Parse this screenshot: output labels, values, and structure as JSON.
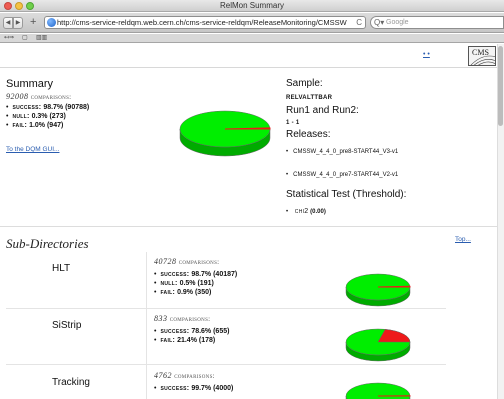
{
  "window": {
    "title": "RelMon Summary"
  },
  "toolbar": {
    "url": "http://cms-service-reldqm.web.cern.ch/cms-service-reldqm/ReleaseMonitoring/CMSSW",
    "search_placeholder": "Google",
    "back_icon": "◀",
    "forward_icon": "▶",
    "add_label": "+",
    "reload_label": "C",
    "search_glyph": "Q▾"
  },
  "bookmarks": {
    "items": [
      "↤⇒",
      "▢",
      "▥▥"
    ]
  },
  "header": {
    "dots_link": "• •",
    "logo_text": "CMS"
  },
  "summary": {
    "title": "Summary",
    "count": "92008",
    "count_suffix": "comparisons:",
    "items": [
      {
        "label": "success:",
        "value": "98.7% (90788)"
      },
      {
        "label": "null:",
        "value": "0.3% (273)"
      },
      {
        "label": "fail:",
        "value": "1.0% (947)"
      }
    ],
    "dqm_link": "To the DQM GUI..."
  },
  "sample": {
    "sample_heading": "Sample:",
    "sample_value": "RELVALTTBAR",
    "run_heading": "Run1 and Run2:",
    "run_value": "1 - 1",
    "releases_heading": "Releases:",
    "releases": [
      "CMSSW_4_4_0_pre8-START44_V3-v1",
      "CMSSW_4_4_0_pre7-START44_V2-v1"
    ],
    "stat_heading": "Statistical Test (Threshold):",
    "stat_label": "chi2",
    "stat_value": "(0.00)"
  },
  "subdirs": {
    "title": "Sub-Directories",
    "top_link": "Top...",
    "rows": [
      {
        "name": "HLT",
        "count": "40728",
        "count_suffix": "comparisons:",
        "items": [
          {
            "label": "success:",
            "value": "98.7% (40187)"
          },
          {
            "label": "null:",
            "value": "0.5% (191)"
          },
          {
            "label": "fail:",
            "value": "0.9% (350)"
          }
        ],
        "fail_fraction": 0.009
      },
      {
        "name": "SiStrip",
        "count": "833",
        "count_suffix": "comparisons:",
        "items": [
          {
            "label": "success:",
            "value": "78.6% (655)"
          },
          {
            "label": "fail:",
            "value": "21.4% (178)"
          }
        ],
        "fail_fraction": 0.214
      },
      {
        "name": "Tracking",
        "count": "4762",
        "count_suffix": "comparisons:",
        "items": [
          {
            "label": "success:",
            "value": "99.7% (4000)"
          }
        ],
        "fail_fraction": 0.003
      }
    ]
  },
  "colors": {
    "success": "#00ee00",
    "fail": "#ee1a1a",
    "link": "#2a5db0"
  },
  "pie_fail_fractions": {
    "summary": 0.01
  }
}
